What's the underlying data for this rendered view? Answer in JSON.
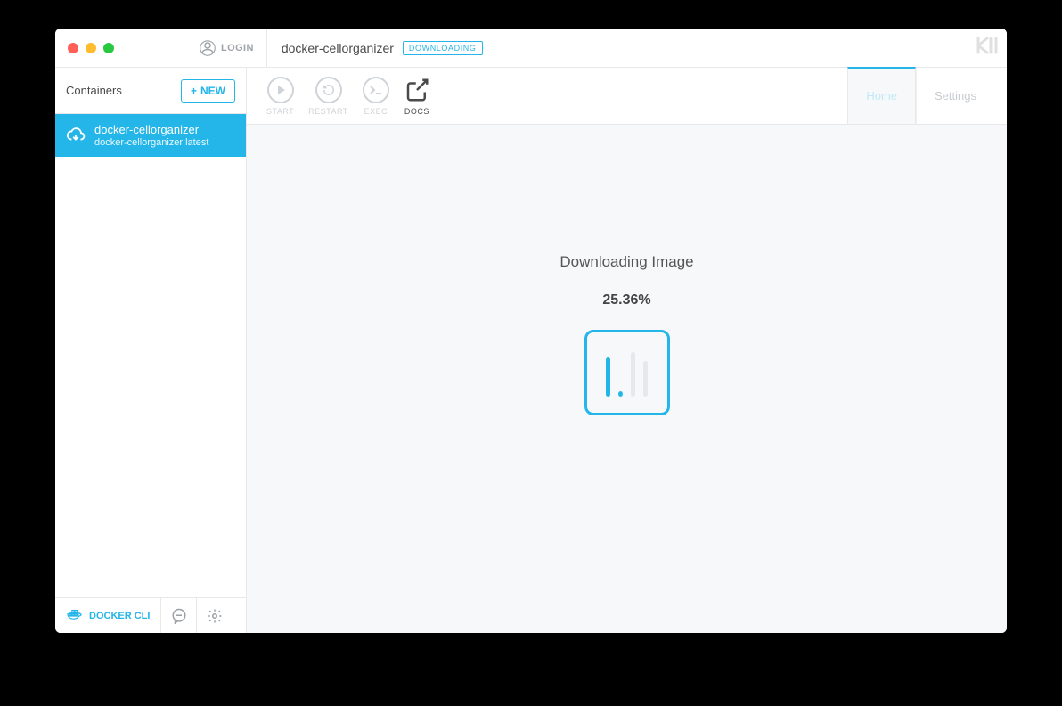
{
  "header": {
    "login_label": "LOGIN",
    "title": "docker-cellorganizer",
    "badge": "DOWNLOADING",
    "brand": "K"
  },
  "sidebar": {
    "title": "Containers",
    "new_label": "NEW",
    "items": [
      {
        "name": "docker-cellorganizer",
        "sub": "docker-cellorganizer:latest"
      }
    ],
    "footer": {
      "cli_label": "DOCKER CLI"
    }
  },
  "toolbar": {
    "start": "START",
    "restart": "RESTART",
    "exec": "EXEC",
    "docs": "DOCS"
  },
  "tabs": {
    "home": "Home",
    "settings": "Settings"
  },
  "status": {
    "title": "Downloading Image",
    "percent": "25.36%"
  }
}
